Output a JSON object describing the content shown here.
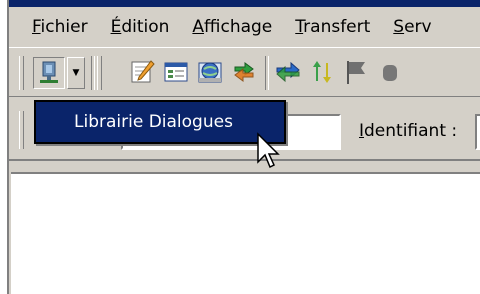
{
  "menubar": {
    "items": [
      {
        "accel": "F",
        "rest": "ichier"
      },
      {
        "accel": "É",
        "rest": "dition"
      },
      {
        "accel": "A",
        "rest": "ffichage"
      },
      {
        "accel": "T",
        "rest": "ransfert"
      },
      {
        "accel": "S",
        "rest": "erv"
      }
    ]
  },
  "toolbar": {
    "icons": [
      "connect-icon",
      "dropdown-arrow-icon",
      "edit-icon",
      "properties-icon",
      "globe-window-icon",
      "transfer-icon",
      "refresh-icon",
      "sync-icon",
      "flag-icon"
    ]
  },
  "toolbar2": {
    "identifiant_accel": "I",
    "identifiant_rest": "dentifiant :"
  },
  "popup": {
    "label": "Librairie Dialogues"
  },
  "colors": {
    "menu_highlight": "#0a246a",
    "chrome": "#d4d0c8"
  }
}
